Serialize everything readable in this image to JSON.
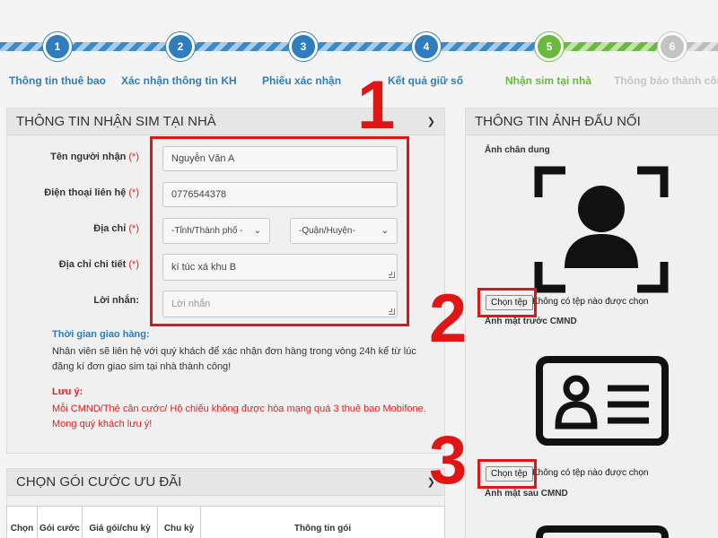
{
  "stepper": {
    "steps": [
      {
        "number": "1",
        "label": "Thông tin thuê bao",
        "state": "done"
      },
      {
        "number": "2",
        "label": "Xác nhận thông tin KH",
        "state": "done"
      },
      {
        "number": "3",
        "label": "Phiếu xác nhận",
        "state": "done"
      },
      {
        "number": "4",
        "label": "Kết quả giữ số",
        "state": "done"
      },
      {
        "number": "5",
        "label": "Nhận sim tại nhà",
        "state": "current"
      },
      {
        "number": "6",
        "label": "Thông báo thành công",
        "state": "pending"
      }
    ]
  },
  "receive_panel": {
    "title": "THÔNG TIN NHẬN SIM TẠI NHÀ",
    "required_mark": "(*)",
    "fields": {
      "name": {
        "label": "Tên người nhận",
        "value": "Nguyễn Văn A"
      },
      "phone": {
        "label": "Điện thoại liên hệ",
        "value": "0776544378"
      },
      "address": {
        "label": "Địa chỉ",
        "province": "-Tỉnh/Thành phố -",
        "district": "-Quận/Huyện-"
      },
      "address_detail": {
        "label": "Địa chỉ chi tiết",
        "value": "kí túc xá khu B"
      },
      "message": {
        "label": "Lời nhắn:",
        "placeholder": "Lời nhắn"
      }
    },
    "delivery_title": "Thời gian giao hàng:",
    "delivery_text": "Nhân viên sẽ liên hệ với quý khách để xác nhận đơn hàng trong vòng 24h kể từ lúc đăng kí đơn giao sim tại nhà thành công!",
    "note_title": "Lưu ý:",
    "note_text": "Mỗi CMND/Thẻ căn cước/ Hộ chiếu không được hòa mạng quá 3 thuê bao Mobifone. Mong quý khách lưu ý!"
  },
  "package_panel": {
    "title": "CHỌN GÓI CƯỚC ƯU ĐÃI",
    "columns": [
      "Chọn",
      "Gói cước",
      "Giá gói/chu kỳ",
      "Chu kỳ",
      "Thông tin gói"
    ]
  },
  "photo_panel": {
    "title": "THÔNG TIN ẢNH ĐẤU NỐI",
    "portrait_label": "Ảnh chân dung",
    "front_label": "Ảnh mặt trước CMND",
    "back_label": "Ảnh mặt sau CMND",
    "choose_file_label": "Chọn tệp",
    "no_file_text": "Không có tệp nào được chọn"
  },
  "annotations": [
    "1",
    "2",
    "3"
  ],
  "colors": {
    "step_done": "#2f7dbd",
    "step_current": "#6ab83f",
    "step_pending": "#c4c4c4",
    "required": "#e02020",
    "annotation": "#e01515"
  }
}
